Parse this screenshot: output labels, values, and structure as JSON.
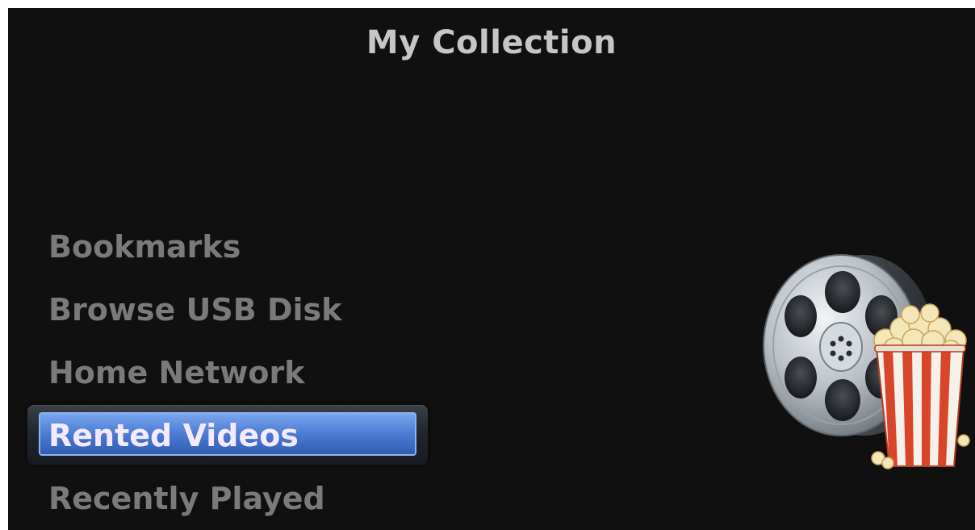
{
  "header": {
    "title": "My Collection"
  },
  "menu": {
    "items": [
      {
        "label": "Bookmarks",
        "selected": false
      },
      {
        "label": "Browse USB Disk",
        "selected": false
      },
      {
        "label": "Home Network",
        "selected": false
      },
      {
        "label": "Rented Videos",
        "selected": true
      },
      {
        "label": "Recently Played",
        "selected": false
      }
    ]
  },
  "art": {
    "icons": [
      "film-reel-icon",
      "popcorn-bucket-icon"
    ]
  },
  "colors": {
    "background": "#101010",
    "title_text": "#c6c6c6",
    "menu_text": "#7a7a7a",
    "selected_text": "#f5e9ff",
    "selection_blue": "#4f7fd6",
    "popcorn_stripe_red": "#d9452b"
  }
}
